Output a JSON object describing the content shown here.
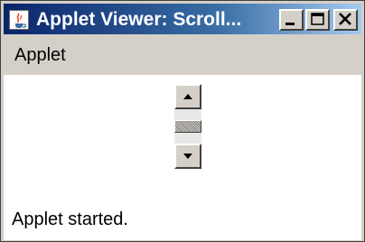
{
  "window": {
    "title": "Applet Viewer: Scroll...",
    "buttons": {
      "minimize_icon": "minimize-icon",
      "maximize_icon": "maximize-icon",
      "close_icon": "close-icon"
    }
  },
  "menubar": {
    "items": [
      {
        "label": "Applet"
      }
    ]
  },
  "scrollbar": {
    "orientation": "vertical",
    "position": 0.5,
    "up_icon": "arrow-up-icon",
    "down_icon": "arrow-down-icon"
  },
  "status": {
    "text": "Applet started."
  },
  "colors": {
    "title_active_start": "#0a246a",
    "title_active_end": "#a6caf0",
    "face": "#d4d0c8",
    "content_bg": "#ffffff"
  }
}
